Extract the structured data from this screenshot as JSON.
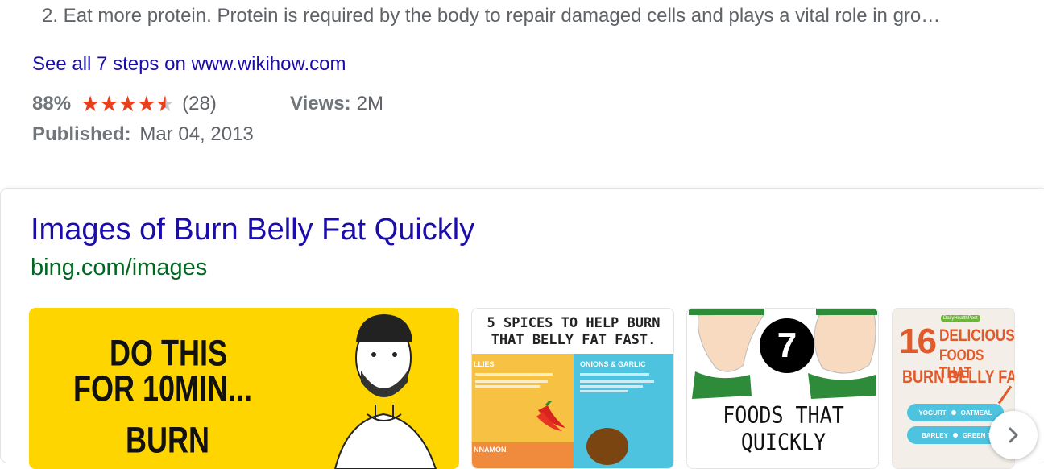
{
  "step": {
    "text": "2. Eat more protein. Protein is required by the body to repair damaged cells and plays a vital role in gro…"
  },
  "see_all_link": "See all 7 steps on www.wikihow.com",
  "rating": {
    "percent": "88%",
    "count": "(28)",
    "stars_value": 4.5,
    "stars_max": 5,
    "star_color": "#e8401c"
  },
  "views": {
    "label": "Views:",
    "value": "2M"
  },
  "published": {
    "label": "Published:",
    "value": "Mar 04, 2013"
  },
  "images_card": {
    "title": "Images of Burn Belly Fat Quickly",
    "source": "bing.com/images",
    "thumbnails": [
      {
        "line1": "DO THIS",
        "line2": "FOR 10MIN...",
        "line3": "BURN"
      },
      {
        "heading1": "5 SPICES TO HELP BURN",
        "heading2": "THAT BELLY FAT FAST.",
        "panel_left_title": "LLIES",
        "panel_right_title": "ONIONS & GARLIC",
        "panel_bottom_title": "NNAMON"
      },
      {
        "number": "7",
        "caption": "FOODS THAT QUICKLY"
      },
      {
        "brand": "DailyHealthPost",
        "number": "16",
        "word1": "DELICIOUS",
        "word2": "FOODS THAT",
        "word3": "BURN BELLY FAT",
        "pill1a": "YOGURT",
        "pill1b": "OATMEAL",
        "pill2a": "BARLEY",
        "pill2b": "GREEN TE"
      }
    ]
  },
  "colors": {
    "link": "#1a0dab",
    "url_green": "#006621",
    "text_gray": "#5f6368",
    "thumb_yellow": "#ffd500"
  }
}
